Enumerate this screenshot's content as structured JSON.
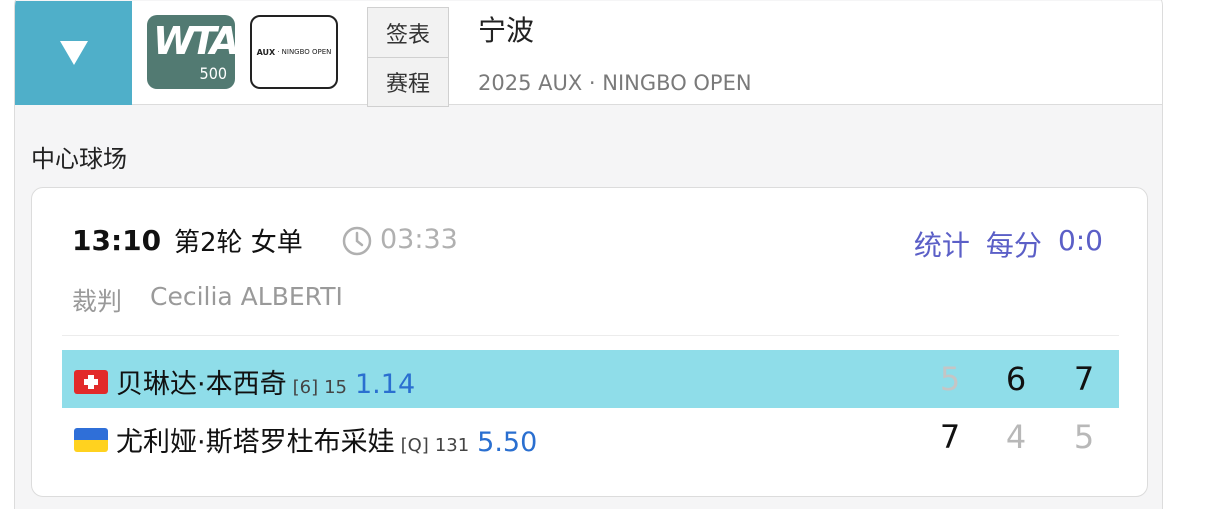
{
  "header": {
    "wta_logo": {
      "text": "WTA",
      "tier": "500"
    },
    "tournament_logo_text": {
      "brand": "AUX",
      "rest": "· NINGBO OPEN"
    },
    "tabs": [
      {
        "label": "签表"
      },
      {
        "label": "赛程"
      }
    ],
    "title": "宁波",
    "subtitle": "2025 AUX · NINGBO OPEN"
  },
  "court": {
    "name": "中心球场"
  },
  "match": {
    "time": "13:10",
    "round": "第2轮 女单",
    "duration": "03:33",
    "links": [
      {
        "label": "统计"
      },
      {
        "label": "每分"
      },
      {
        "label": "0:0"
      }
    ],
    "umpire_label": "裁判",
    "umpire_name": "Cecilia ALBERTI",
    "players": [
      {
        "name": "贝琳达·本西奇",
        "seed": "[6]",
        "rank": "15",
        "odds": "1.14",
        "flag": "flag-switzerland",
        "sets": [
          "5",
          "6",
          "7"
        ],
        "winner": true
      },
      {
        "name": "尤利娅·斯塔罗杜布采娃",
        "seed": "[Q]",
        "rank": "131",
        "odds": "5.50",
        "flag": "flag-ukraine",
        "sets": [
          "7",
          "4",
          "5"
        ],
        "winner": false
      }
    ]
  },
  "colors": {
    "accent": "#4fafc9",
    "winner_row": "#8fdde9",
    "link": "#5b5fc7",
    "odds": "#2a6fd0",
    "wta_logo_bg": "#527a72"
  }
}
